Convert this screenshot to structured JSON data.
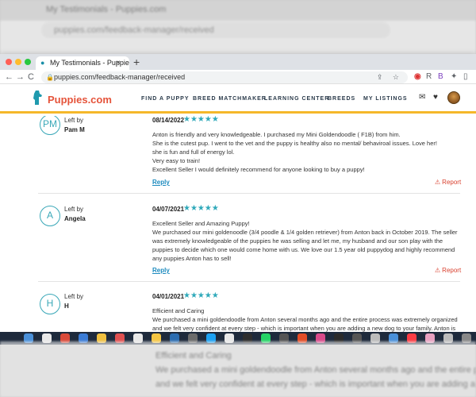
{
  "background": {
    "tab_title": "My Testimonials - Puppies.com",
    "url": "puppies.com/feedback-manager/received",
    "bottom_lines": [
      "Efficient and Caring",
      "We purchased a mini goldendoodle from Anton several months ago and the entire process was extremely organized",
      "and we felt very confident at every step - which is important when you are adding a new dog to your family. Anton is"
    ]
  },
  "browser": {
    "tab_title": "My Testimonials - Puppies.com",
    "tab_close": "×",
    "new_tab": "+",
    "url": "puppies.com/feedback-manager/received",
    "back": "←",
    "forward": "→",
    "reload": "C",
    "lock": "🔒",
    "omni_icons": "⇪ ☆",
    "ext_r": "R",
    "ext_puzzle": "✦",
    "ext_sidebar": "▯"
  },
  "site": {
    "logo": "Puppies.com",
    "nav": [
      "FIND A PUPPY",
      "BREED MATCHMAKER",
      "LEARNING CENTER",
      "BREEDS",
      "MY LISTINGS"
    ],
    "mail_icon": "✉",
    "heart_icon": "♥"
  },
  "reviews": [
    {
      "initials": "PM",
      "left_by_label": "Left by",
      "name": "Pam M",
      "date": "08/14/2022",
      "stars": "★★★★★",
      "rating": 5,
      "lines": [
        "Anton is friendly and very knowledgeable. I purchased my Mini Goldendoodle ( F1B) from him.",
        "She is the cutest pup. I went to the vet and the puppy is healthy also no mental/ behaviroal issues. Love her!",
        "she is fun and full of energy lol.",
        "Very easy to train!",
        "Excellent Seller I would definitely recommend for anyone looking to buy a puppy!"
      ],
      "reply": "Reply",
      "report": "Report"
    },
    {
      "initials": "A",
      "left_by_label": "Left by",
      "name": "Angela",
      "date": "04/07/2021",
      "stars": "★★★★★",
      "rating": 5,
      "lines": [
        "Excellent Seller and Amazing Puppy!",
        "We purchased our mini goldenoodle (3/4 poodle & 1/4 golden retriever) from Anton back in October 2019. The seller",
        "was extremely knowledgeable of the puppies he was selling and let me, my husband and our son play with the",
        "puppies to decide which one would come home with us. We love our 1.5 year old puppydog and highly recommend",
        "any puppies Anton has to sell!"
      ],
      "reply": "Reply",
      "report": "Report"
    },
    {
      "initials": "H",
      "left_by_label": "Left by",
      "name": "H",
      "date": "04/01/2021",
      "stars": "★★★★★",
      "rating": 5,
      "lines": [
        "Efficient and Caring",
        "We purchased a mini goldendoodle from Anton several months ago and the entire process was extremely organized",
        "and we felt very confident at every step - which is important when you are adding a new dog to your family. Anton is"
      ]
    }
  ],
  "dock_colors": [
    "#4a90d9",
    "#e8e8e8",
    "#d94a3a",
    "#3a7bd5",
    "#f0c040",
    "#e05050",
    "#e8e8e8",
    "#f5c542",
    "#2b6cb0",
    "#6b6b6b",
    "#1da1f2",
    "#e8e8e8",
    "#2e2e2e",
    "#25d366",
    "#555555",
    "#e34c26",
    "#d94a8a",
    "#2a2a2a",
    "#555555",
    "#bbbbbb",
    "#4a90d9",
    "#fc3c44",
    "#e8a0c0",
    "#bbbbbb",
    "#888888"
  ]
}
